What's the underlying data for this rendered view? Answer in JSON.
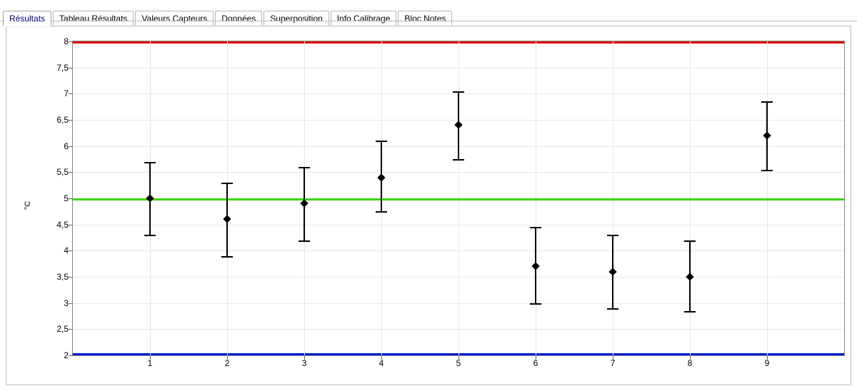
{
  "tabs": {
    "items": [
      {
        "label": "Résultats",
        "active": true
      },
      {
        "label": "Tableau Résultats",
        "active": false
      },
      {
        "label": "Valeurs Capteurs",
        "active": false
      },
      {
        "label": "Données",
        "active": false
      },
      {
        "label": "Superposition",
        "active": false
      },
      {
        "label": "Info Calibrage",
        "active": false
      },
      {
        "label": "Bloc Notes",
        "active": false
      }
    ]
  },
  "chart": {
    "ylabel": "°C"
  },
  "chart_data": {
    "type": "errorbar",
    "xlabel": "",
    "ylabel": "°C",
    "xlim": [
      0,
      10
    ],
    "ylim": [
      2,
      8
    ],
    "x_ticks": [
      1,
      2,
      3,
      4,
      5,
      6,
      7,
      8,
      9
    ],
    "y_ticks": [
      2,
      2.5,
      3,
      3.5,
      4,
      4.5,
      5,
      5.5,
      6,
      6.5,
      7,
      7.5,
      8
    ],
    "y_tick_labels": [
      "2",
      "2,5",
      "3",
      "3,5",
      "4",
      "4,5",
      "5",
      "5,5",
      "6",
      "6,5",
      "7",
      "7,5",
      "8"
    ],
    "reference_lines": [
      {
        "value": 8,
        "color": "#e00000",
        "role": "upper_limit"
      },
      {
        "value": 5,
        "color": "#39d600",
        "role": "target"
      },
      {
        "value": 2,
        "color": "#0020d0",
        "role": "lower_limit"
      }
    ],
    "series": [
      {
        "name": "results",
        "points": [
          {
            "x": 1,
            "y": 5.0,
            "low": 4.3,
            "high": 5.7
          },
          {
            "x": 2,
            "y": 4.6,
            "low": 3.9,
            "high": 5.3
          },
          {
            "x": 3,
            "y": 4.9,
            "low": 4.2,
            "high": 5.6
          },
          {
            "x": 4,
            "y": 5.4,
            "low": 4.75,
            "high": 6.1
          },
          {
            "x": 5,
            "y": 6.4,
            "low": 5.75,
            "high": 7.05
          },
          {
            "x": 6,
            "y": 3.7,
            "low": 3.0,
            "high": 4.45
          },
          {
            "x": 7,
            "y": 3.6,
            "low": 2.9,
            "high": 4.3
          },
          {
            "x": 8,
            "y": 3.5,
            "low": 2.85,
            "high": 4.2
          },
          {
            "x": 9,
            "y": 6.2,
            "low": 5.55,
            "high": 6.85
          }
        ]
      }
    ]
  }
}
